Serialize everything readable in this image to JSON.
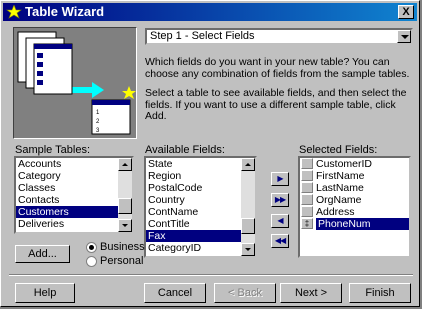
{
  "window": {
    "title": "Table Wizard",
    "close_label": "X"
  },
  "step_combo": {
    "value": "Step 1 - Select Fields"
  },
  "instructions": {
    "p1": "Which fields do you want in your new table? You can choose any combination of fields from the sample tables.",
    "p2": "Select a table to see available fields, and then select the fields. If you want to use a different sample table, click Add."
  },
  "sample_tables": {
    "label": "Sample Tables:",
    "items": [
      "Accounts",
      "Category",
      "Classes",
      "Contacts",
      "Customers",
      "Deliveries"
    ],
    "selected": "Customers"
  },
  "available_fields": {
    "label": "Available Fields:",
    "items": [
      "State",
      "Region",
      "PostalCode",
      "Country",
      "ContName",
      "ContTitle",
      "Fax",
      "CategoryID"
    ],
    "selected": "Fax"
  },
  "selected_fields": {
    "label": "Selected Fields:",
    "items": [
      "CustomerID",
      "FirstName",
      "LastName",
      "OrgName",
      "Address",
      "PhoneNum"
    ],
    "selected": "PhoneNum",
    "key_marker": "‡"
  },
  "move_buttons": [
    {
      "name": "add-field-button",
      "glyph": "▶"
    },
    {
      "name": "add-all-fields-button",
      "glyph": "▶▶"
    },
    {
      "name": "remove-field-button",
      "glyph": "◀"
    },
    {
      "name": "remove-all-fields-button",
      "glyph": "◀◀"
    }
  ],
  "add_button": "Add...",
  "radio": {
    "business": "Business",
    "personal": "Personal",
    "selected": "Business"
  },
  "footer": {
    "help": "Help",
    "cancel": "Cancel",
    "back": "< Back",
    "next": "Next >",
    "finish": "Finish"
  },
  "illustration": {
    "row_text": "xx"
  },
  "colors": {
    "title_start": "#000080",
    "title_end": "#1084d0",
    "face": "#c0c0c0",
    "selection": "#000080",
    "cyan": "#00ffff"
  }
}
